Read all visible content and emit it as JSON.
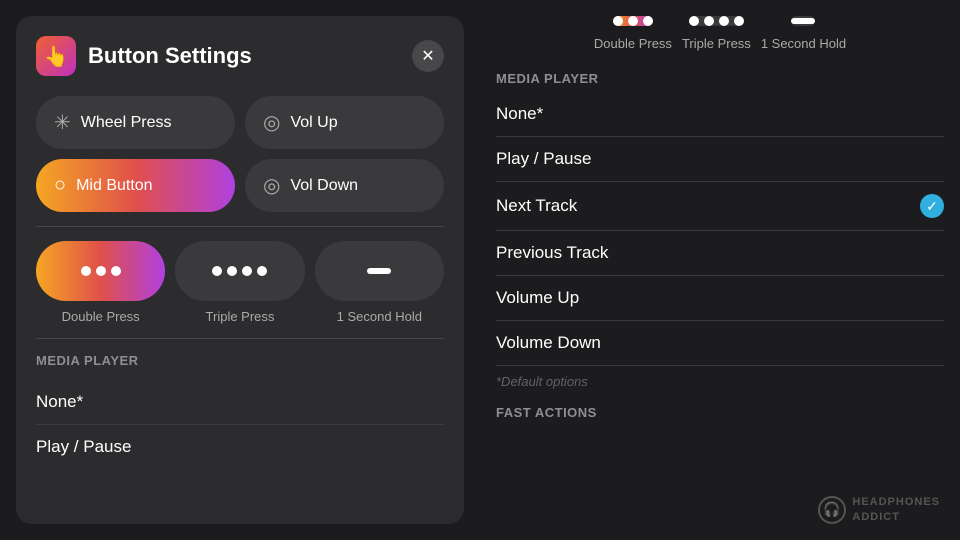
{
  "leftPanel": {
    "modal": {
      "title": "Button Settings",
      "appIconSymbol": "👆",
      "closeLabel": "✕",
      "buttons": [
        {
          "id": "wheel-press",
          "label": "Wheel Press",
          "icon": "✳",
          "active": false
        },
        {
          "id": "vol-up",
          "label": "Vol Up",
          "icon": "◎",
          "active": false
        },
        {
          "id": "mid-button",
          "label": "Mid Button",
          "icon": "○",
          "active": true
        },
        {
          "id": "vol-down",
          "label": "Vol Down",
          "icon": "◎",
          "active": false
        }
      ],
      "pressButtons": [
        {
          "id": "double-press",
          "label": "Double Press",
          "type": "double",
          "active": true
        },
        {
          "id": "triple-press",
          "label": "Triple Press",
          "type": "triple",
          "active": false
        },
        {
          "id": "one-second-hold",
          "label": "1 Second Hold",
          "type": "hold",
          "active": false
        }
      ],
      "sectionLabel": "MEDIA PLAYER",
      "menuItems": [
        {
          "id": "none",
          "label": "None*"
        },
        {
          "id": "play-pause",
          "label": "Play / Pause"
        }
      ]
    }
  },
  "rightPanel": {
    "topButtons": [
      {
        "id": "double-press-right",
        "label": "Double Press",
        "type": "double",
        "active": false
      },
      {
        "id": "triple-press-right",
        "label": "Triple Press",
        "type": "triple",
        "active": false
      },
      {
        "id": "one-second-hold-right",
        "label": "1 Second Hold",
        "type": "hold",
        "active": false
      }
    ],
    "sectionLabel": "MEDIA PLAYER",
    "menuItems": [
      {
        "id": "none-right",
        "label": "None*",
        "checked": false
      },
      {
        "id": "play-pause-right",
        "label": "Play / Pause",
        "checked": false
      },
      {
        "id": "next-track",
        "label": "Next Track",
        "checked": true
      },
      {
        "id": "previous-track",
        "label": "Previous Track",
        "checked": false
      },
      {
        "id": "volume-up",
        "label": "Volume Up",
        "checked": false
      },
      {
        "id": "volume-down",
        "label": "Volume Down",
        "checked": false
      }
    ],
    "defaultNote": "*Default options",
    "fastActionsLabel": "FAST ACTIONS",
    "watermark": {
      "text": "HEADPHONES\nADDICT",
      "icon": "🎧"
    }
  }
}
